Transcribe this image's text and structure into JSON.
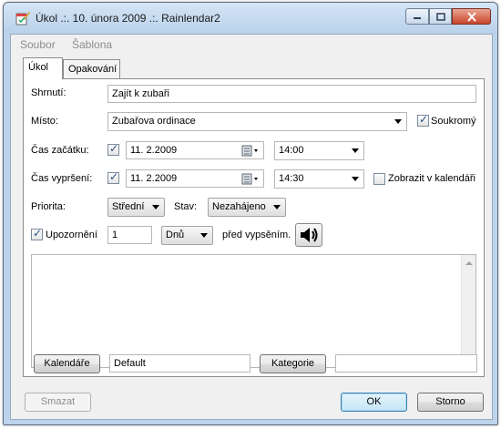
{
  "window": {
    "title": "Úkol .:. 10. února 2009 .:. Rainlendar2",
    "app_icon": "rainlendar-icon",
    "controls": {
      "minimize": "minimize-icon",
      "maximize": "maximize-icon",
      "close": "close-icon"
    }
  },
  "menu": {
    "items": [
      "Soubor",
      "Šablona"
    ]
  },
  "tabs": [
    {
      "label": "Úkol",
      "active": true
    },
    {
      "label": "Opakování",
      "active": false
    }
  ],
  "form": {
    "summary": {
      "label": "Shrnutí:",
      "value": "Zajít k zubaři"
    },
    "location": {
      "label": "Místo:",
      "value": "Zubařova ordinace"
    },
    "private": {
      "label": "Soukromý",
      "checked": true
    },
    "start": {
      "label": "Čas začátku:",
      "checked": true,
      "date": "11.  2.2009",
      "time": "14:00"
    },
    "due": {
      "label": "Čas vypršení:",
      "checked": true,
      "date": "11.  2.2009",
      "time": "14:30"
    },
    "show_in_calendar": {
      "label": "Zobrazit v kalendáři",
      "checked": false
    },
    "priority": {
      "label": "Priorita:",
      "value": "Střední"
    },
    "status": {
      "label": "Stav:",
      "value": "Nezahájeno"
    },
    "reminder": {
      "label": "Upozornění",
      "checked": true,
      "amount": "1",
      "unit": "Dnů",
      "suffix": "před vypsěním."
    },
    "notes": {
      "value": ""
    }
  },
  "bottom": {
    "calendars_button": "Kalendáře",
    "calendar_value": "Default",
    "categories_button": "Kategorie",
    "categories_value": ""
  },
  "footer": {
    "delete_button": "Smazat",
    "ok_button": "OK",
    "cancel_button": "Storno"
  },
  "colors": {
    "title_bar": "#bcd3ec",
    "close_button": "#c8452c",
    "check_mark": "#2a4f86",
    "default_button_border": "#3c7fb1"
  }
}
